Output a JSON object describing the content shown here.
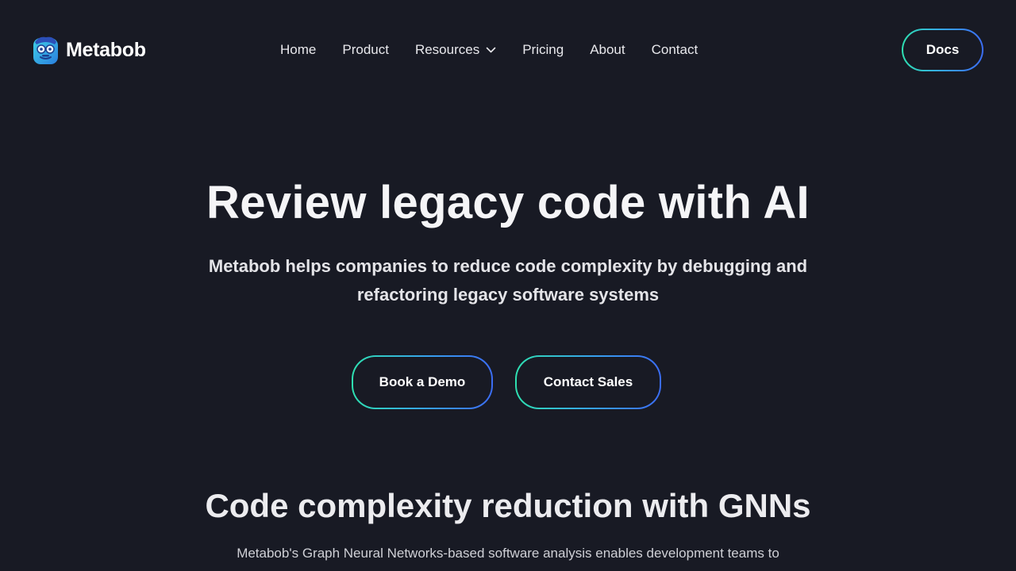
{
  "brand": {
    "name": "Metabob",
    "logo_icon": "metabob-mascot-icon",
    "colors": {
      "background": "#181a24",
      "gradient_start": "#2ee0b0",
      "gradient_end": "#3b6cf2"
    }
  },
  "nav": {
    "items": [
      {
        "label": "Home"
      },
      {
        "label": "Product"
      },
      {
        "label": "Resources",
        "icon": "chevron-down-icon"
      },
      {
        "label": "Pricing"
      },
      {
        "label": "About"
      },
      {
        "label": "Contact"
      }
    ],
    "docs_label": "Docs"
  },
  "hero": {
    "title": "Review legacy code with AI",
    "subtitle": "Metabob helps companies to reduce code complexity by debugging and refactoring legacy software systems",
    "primary_cta": "Book a Demo",
    "secondary_cta": "Contact Sales"
  },
  "section": {
    "title": "Code complexity reduction with GNNs",
    "body": "Metabob's Graph Neural Networks-based software analysis enables development teams to"
  }
}
